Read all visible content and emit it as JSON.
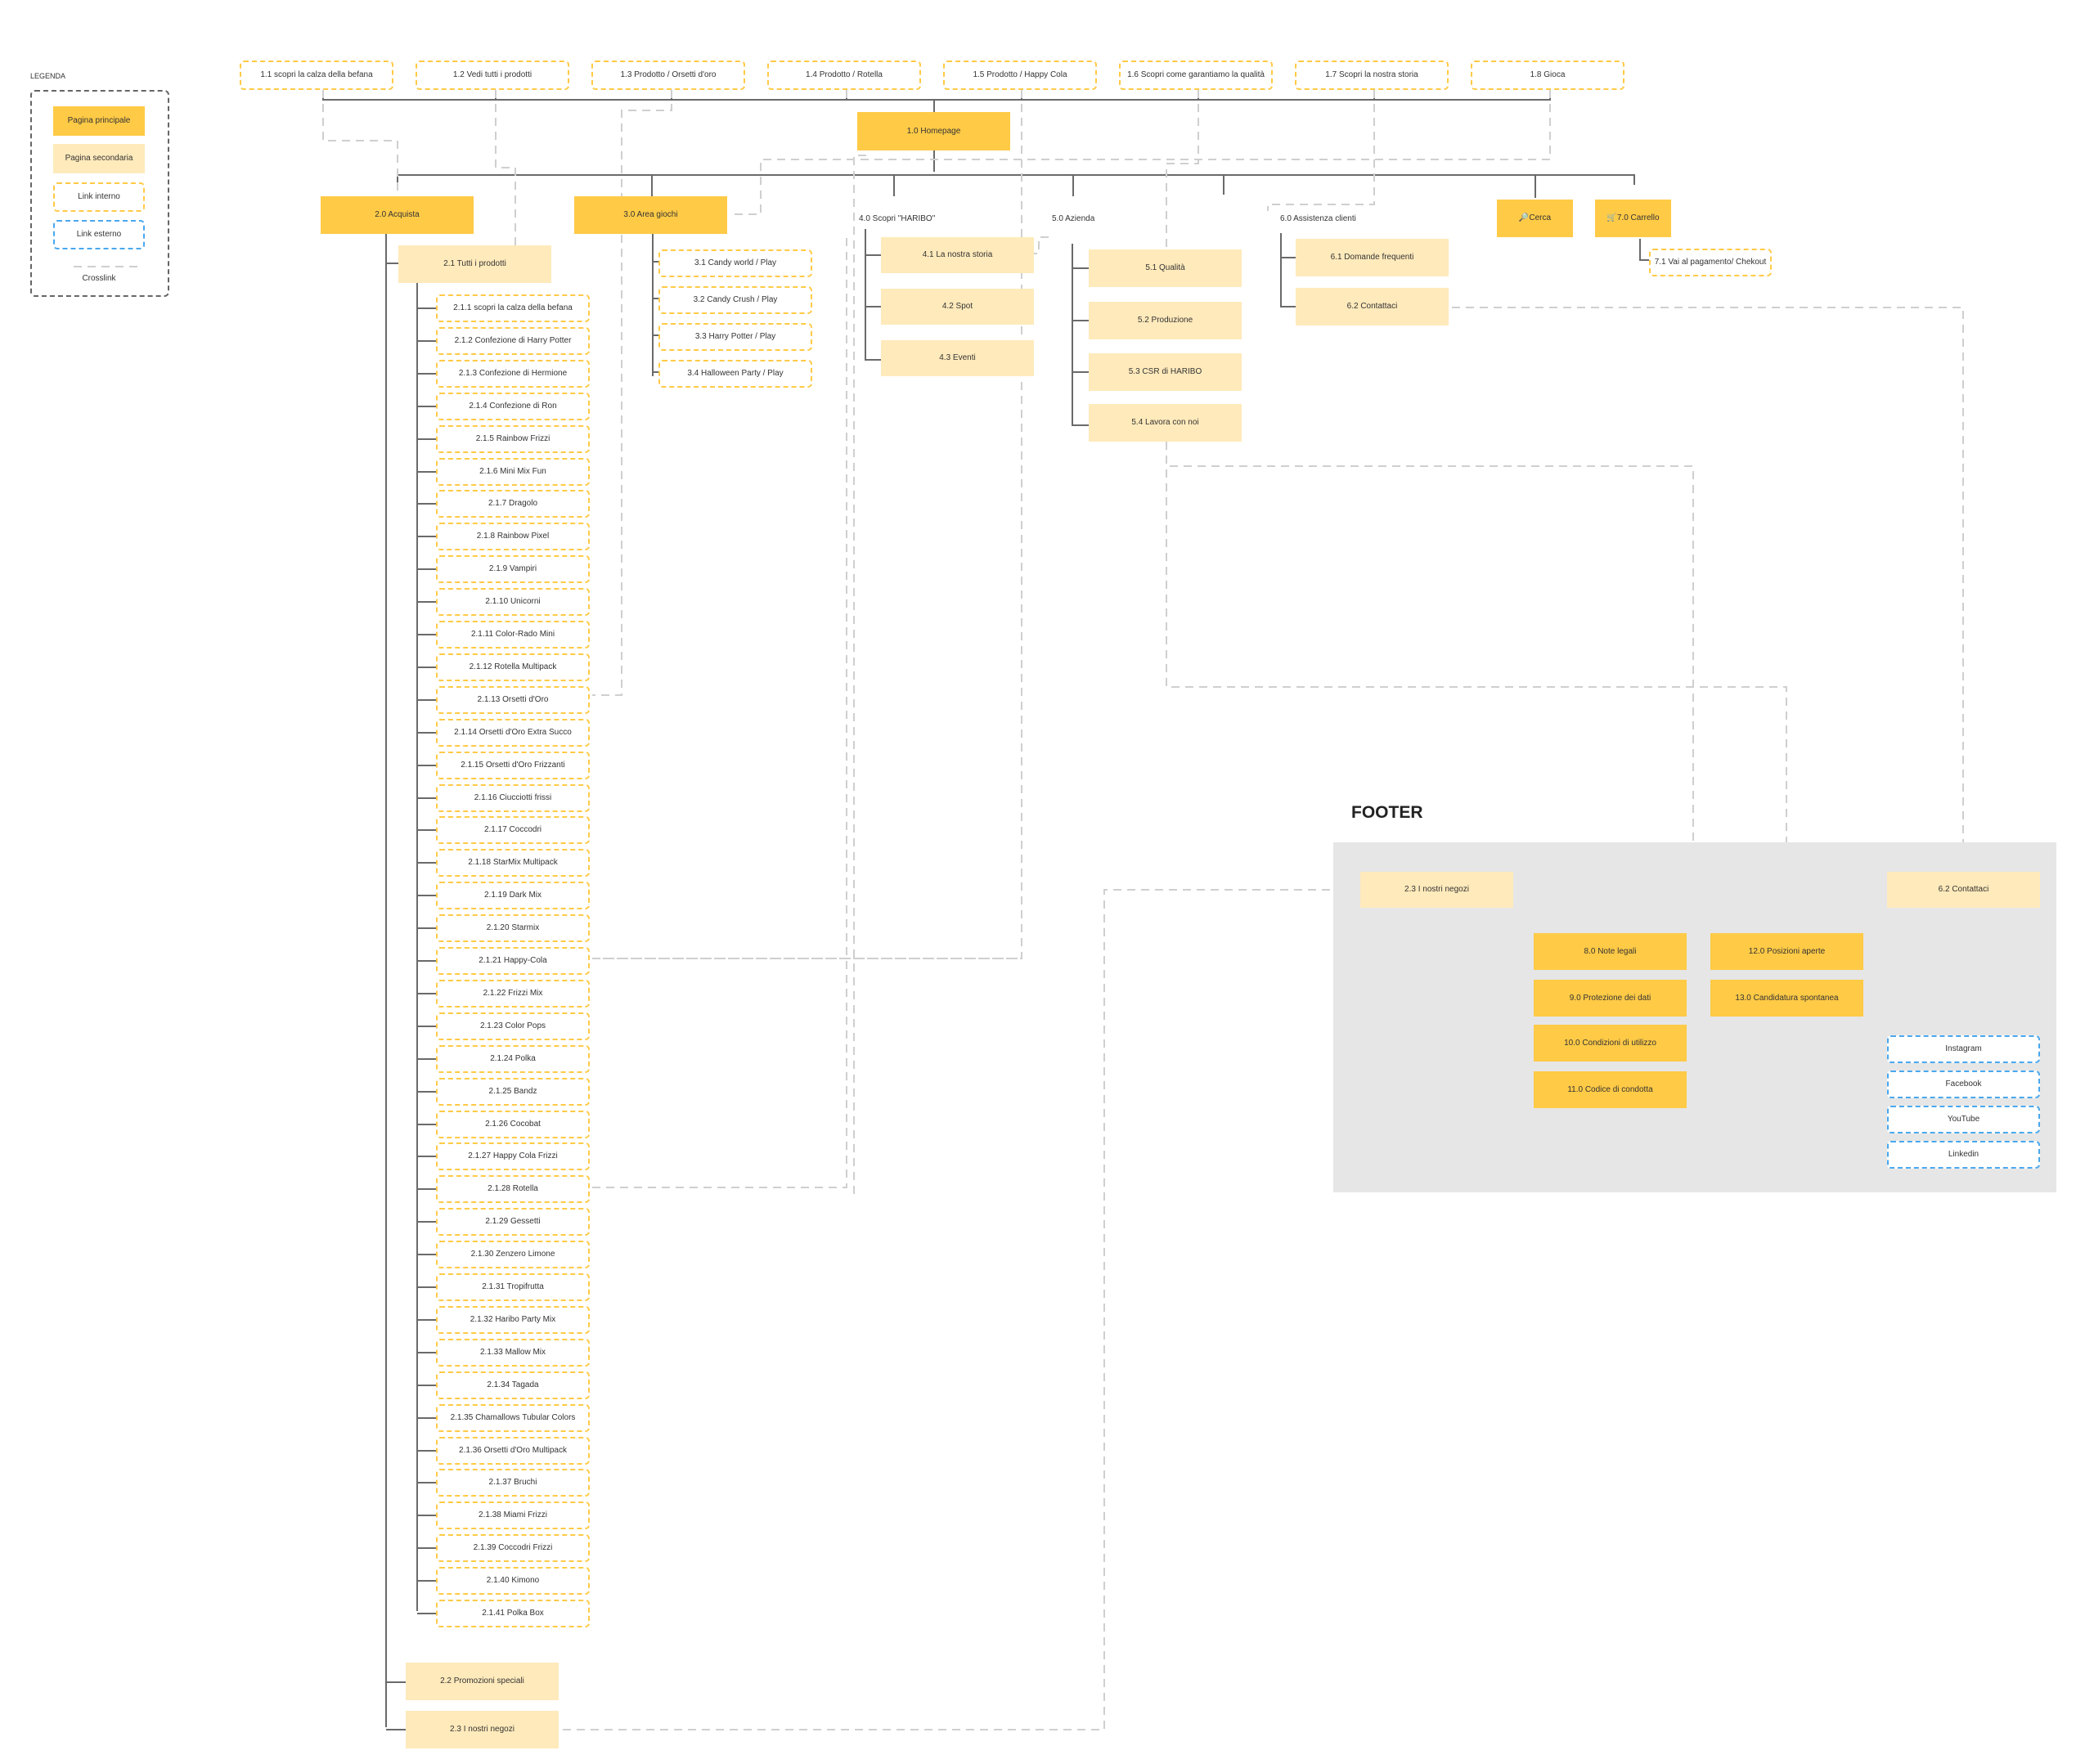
{
  "legend": {
    "title": "LEGENDA",
    "main_page": "Pagina principale",
    "secondary_page": "Pagina secondaria",
    "internal_link": "Link interno",
    "external_link": "Link esterno",
    "crosslink": "Crosslink"
  },
  "homepage_links": [
    "1.1 scopri la calza della befana",
    "1.2 Vedi tutti i prodotti",
    "1.3 Prodotto / Orsetti d'oro",
    "1.4  Prodotto / Rotella",
    "1.5  Prodotto /  Happy Cola",
    "1.6 Scopri come garantiamo la qualità",
    "1.7 Scopri la nostra storia",
    "1.8 Gioca"
  ],
  "homepage": "1.0 Homepage",
  "sections": {
    "acquista": "2.0 Acquista",
    "area_giochi": "3.0 Area giochi",
    "scopri_haribo": "4.0 Scopri  \"HARIBO\"",
    "azienda": "5.0 Azienda",
    "assistenza": "6.0 Assistenza clienti",
    "cerca": "🔎Cerca",
    "carrello": "🛒7.0 Carrello"
  },
  "acquista": {
    "tutti_prodotti": "2.1 Tutti i prodotti",
    "products": [
      "2.1.1 scopri la calza della befana",
      "2.1.2 Confezione di Harry Potter",
      "2.1.3 Confezione di Hermione",
      "2.1.4 Confezione di Ron",
      "2.1.5 Rainbow Frizzi",
      "2.1.6 Mini Mix Fun",
      "2.1.7 Dragolo",
      "2.1.8 Rainbow Pixel",
      "2.1.9 Vampiri",
      "2.1.10 Unicorni",
      "2.1.11 Color-Rado Mini",
      "2.1.12 Rotella Multipack",
      "2.1.13 Orsetti d'Oro",
      "2.1.14 Orsetti d'Oro Extra Succo",
      "2.1.15 Orsetti d'Oro Frizzanti",
      "2.1.16 Ciucciotti frissi",
      "2.1.17 Coccodri",
      "2.1.18 StarMix Multipack",
      "2.1.19 Dark Mix",
      "2.1.20 Starmix",
      "2.1.21 Happy-Cola",
      "2.1.22 Frizzi Mix",
      "2.1.23 Color Pops",
      "2.1.24 Polka",
      "2.1.25 Bandz",
      "2.1.26 Cocobat",
      "2.1.27 Happy Cola Frizzi",
      "2.1.28 Rotella",
      "2.1.29 Gessetti",
      "2.1.30 Zenzero Limone",
      "2.1.31 Tropifrutta",
      "2.1.32 Haribo Party Mix",
      "2.1.33 Mallow Mix",
      "2.1.34 Tagada",
      "2.1.35 Chamallows Tubular Colors",
      "2.1.36 Orsetti d'Oro Multipack",
      "2.1.37 Bruchi",
      "2.1.38 Miami Frizzi",
      "2.1.39 Coccodri Frizzi",
      "2.1.40 Kimono",
      "2.1.41 Polka Box"
    ],
    "promozioni": "2.2 Promozioni speciali",
    "negozi": "2.3 I nostri negozi"
  },
  "games": [
    "3.1 Candy world / Play",
    "3.2 Candy Crush / Play",
    "3.3 Harry Potter / Play",
    "3.4 Halloween Party  / Play"
  ],
  "scopri": [
    "4.1 La nostra storia",
    "4.2 Spot",
    "4.3 Eventi"
  ],
  "azienda": [
    "5.1 Qualità",
    "5.2 Produzione",
    "5.3 CSR di HARIBO",
    "5.4 Lavora con noi"
  ],
  "assistenza": [
    "6.1 Domande frequenti",
    "6.2 Contattaci"
  ],
  "carrello": {
    "checkout": "7.1 Vai al pagamento/ Chekout"
  },
  "footer": {
    "title": "FOOTER",
    "negozi": "2.3 I nostri negozi",
    "contattaci": "6.2 Contattaci",
    "legal": [
      "8.0 Note legali",
      "9.0 Protezione dei dati",
      "10.0 Condizioni di utilizzo",
      "11.0 Codice di condotta"
    ],
    "jobs": [
      "12.0 Posizioni aperte",
      "13.0 Candidatura spontanea"
    ],
    "social": [
      "Instagram",
      "Facebook",
      "YouTube",
      "Linkedin"
    ]
  }
}
